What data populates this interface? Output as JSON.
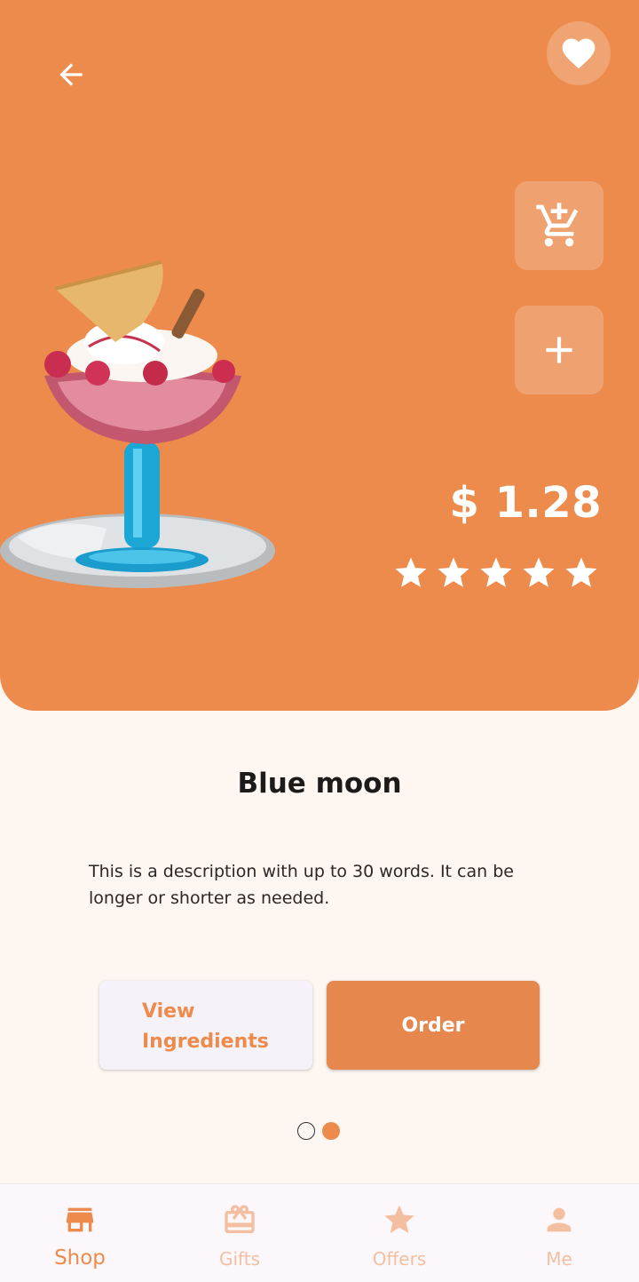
{
  "colors": {
    "accent": "#ec8b4c",
    "background": "#fdf6f1",
    "nav_inactive": "#f3bfa0"
  },
  "header": {
    "back_icon": "arrow-left-icon",
    "favorite_icon": "heart-icon"
  },
  "actions": {
    "cart_icon": "cart-icon",
    "add_icon": "plus-icon"
  },
  "product": {
    "price": "$ 1.28",
    "rating": 5,
    "rating_max": 5,
    "name": "Blue moon",
    "description": "This is a description with up to 30 words. It can be longer or shorter as needed."
  },
  "buttons": {
    "ingredients_label": "View Ingredients",
    "order_label": "Order"
  },
  "pager": {
    "count": 2,
    "active_index": 1
  },
  "bottom_nav": {
    "items": [
      {
        "label": "Shop",
        "icon": "store-icon",
        "active": true
      },
      {
        "label": "Gifts",
        "icon": "gift-icon",
        "active": false
      },
      {
        "label": "Offers",
        "icon": "star-icon",
        "active": false
      },
      {
        "label": "Me",
        "icon": "person-icon",
        "active": false
      }
    ]
  }
}
